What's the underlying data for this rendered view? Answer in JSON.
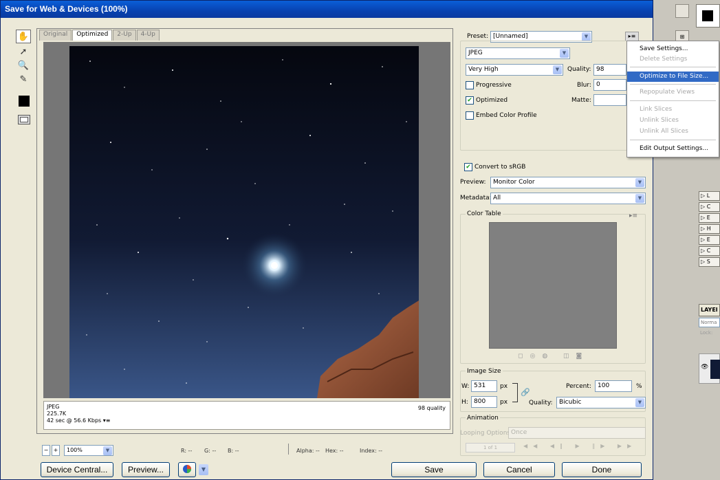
{
  "window": {
    "title": "Save for Web & Devices (100%)"
  },
  "colors": {
    "titlebar": "#0842b0",
    "menu_highlight": "#316ac5",
    "matte_swatch": "#000000",
    "sky_top": "#05070f",
    "sky_bottom": "#3a5688"
  },
  "tools": [
    "hand-icon",
    "slice-select-icon",
    "zoom-icon",
    "eyedropper-icon",
    "eyedropper-color-swatch",
    "toggle-slices-icon"
  ],
  "preview": {
    "tabs": [
      "Original",
      "Optimized",
      "2-Up",
      "4-Up"
    ],
    "active_tab": "Optimized",
    "info_left": [
      "JPEG",
      "225.7K",
      "42 sec @ 56.6 Kbps"
    ],
    "info_right": "98 quality",
    "info_menu_icon": "▾≡"
  },
  "statusbar": {
    "zoom": "100%",
    "r": "R: --",
    "g": "G: --",
    "b": "B: --",
    "alpha": "Alpha: --",
    "hex": "Hex: --",
    "index": "Index: --"
  },
  "buttons": {
    "device_central": "Device Central...",
    "preview": "Preview...",
    "save": "Save",
    "cancel": "Cancel",
    "done": "Done"
  },
  "settings": {
    "preset_label": "Preset:",
    "preset_value": "[Unnamed]",
    "format": "JPEG",
    "compression": "Very High",
    "quality_label": "Quality:",
    "quality": "98",
    "progressive": "Progressive",
    "blur_label": "Blur:",
    "blur": "0",
    "optimized": "Optimized",
    "matte_label": "Matte:",
    "embed_profile": "Embed Color Profile",
    "convert_srgb": "Convert to sRGB",
    "preview_label": "Preview:",
    "preview_value": "Monitor Color",
    "metadata_label": "Metadata:",
    "metadata_value": "All",
    "color_table": "Color Table",
    "image_size": "Image Size",
    "w_label": "W:",
    "width": "531",
    "h_label": "H:",
    "height": "800",
    "px": "px",
    "percent_label": "Percent:",
    "percent": "100",
    "percent_unit": "%",
    "resample_label": "Quality:",
    "resample_value": "Bicubic",
    "animation": "Animation",
    "looping_label": "Looping Options:",
    "looping_value": "Once",
    "frame_counter": "1 of 1"
  },
  "menu": [
    {
      "label": "Save Settings...",
      "state": "normal"
    },
    {
      "label": "Delete Settings",
      "state": "disabled"
    },
    {
      "label": "Optimize to File Size...",
      "state": "highlighted"
    },
    {
      "label": "Repopulate Views",
      "state": "disabled"
    },
    {
      "label": "Link Slices",
      "state": "disabled"
    },
    {
      "label": "Unlink Slices",
      "state": "disabled"
    },
    {
      "label": "Unlink All Slices",
      "state": "disabled"
    },
    {
      "label": "Edit Output Settings...",
      "state": "normal"
    }
  ],
  "background_panel": {
    "layers_tab": "LAYEI",
    "row_labels": [
      "L",
      "C",
      "E",
      "H",
      "E",
      "C",
      "S"
    ],
    "blend_mode": "Norma",
    "lock_label": "Lock:"
  }
}
